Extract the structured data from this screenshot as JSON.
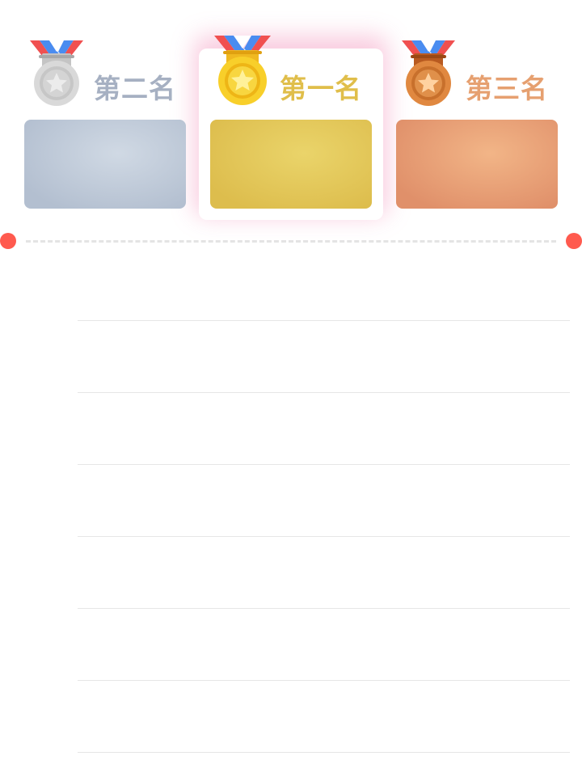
{
  "podium": {
    "ranks": [
      {
        "id": "second",
        "label": "第二名",
        "medal_icon": "silver-medal-icon",
        "text_color": "#a6b0c2",
        "box_center": "#d0d9e4",
        "box_edge": "#b3bfd0"
      },
      {
        "id": "first",
        "label": "第一名",
        "medal_icon": "gold-medal-icon",
        "text_color": "#e0be4a",
        "box_center": "#ead46a",
        "box_edge": "#ddbd4d",
        "highlighted": true
      },
      {
        "id": "third",
        "label": "第三名",
        "medal_icon": "bronze-medal-icon",
        "text_color": "#e6a070",
        "box_center": "#f2b587",
        "box_edge": "#e0906a"
      }
    ]
  },
  "divider": {
    "dot_color": "#ff5a4e"
  },
  "ranking_list": {
    "rows": [
      {},
      {},
      {},
      {},
      {},
      {},
      {}
    ]
  }
}
